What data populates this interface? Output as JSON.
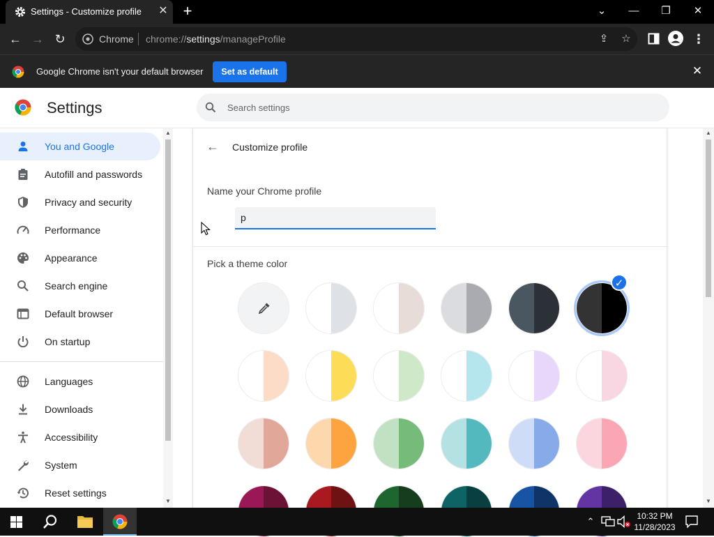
{
  "tab": {
    "title": "Settings - Customize profile",
    "close": "✕",
    "new_tab": "+"
  },
  "window": {
    "minimize": "—",
    "restore": "❐",
    "close": "✕",
    "tab_search": "⌄"
  },
  "toolbar": {
    "back": "←",
    "forward": "→",
    "reload": "↻",
    "site_label": "Chrome",
    "url_prefix": "chrome://",
    "url_host": "settings",
    "url_path": "/manageProfile"
  },
  "infobar": {
    "message": "Google Chrome isn't your default browser",
    "button": "Set as default",
    "close": "✕"
  },
  "header": {
    "title": "Settings",
    "search_placeholder": "Search settings"
  },
  "sidebar": {
    "items": [
      {
        "label": "You and Google",
        "icon": "person-icon",
        "active": true
      },
      {
        "label": "Autofill and passwords",
        "icon": "clipboard-icon"
      },
      {
        "label": "Privacy and security",
        "icon": "shield-icon"
      },
      {
        "label": "Performance",
        "icon": "speedometer-icon"
      },
      {
        "label": "Appearance",
        "icon": "palette-icon"
      },
      {
        "label": "Search engine",
        "icon": "search-icon"
      },
      {
        "label": "Default browser",
        "icon": "browser-icon"
      },
      {
        "label": "On startup",
        "icon": "power-icon"
      },
      {
        "label": "Languages",
        "icon": "globe-icon"
      },
      {
        "label": "Downloads",
        "icon": "download-icon"
      },
      {
        "label": "Accessibility",
        "icon": "accessibility-icon"
      },
      {
        "label": "System",
        "icon": "wrench-icon"
      },
      {
        "label": "Reset settings",
        "icon": "history-icon"
      }
    ]
  },
  "main": {
    "back_label": "←",
    "title": "Customize profile",
    "name_label": "Name your Chrome profile",
    "name_value": "p",
    "theme_label": "Pick a theme color",
    "selected_swatch": 5,
    "swatches": [
      [
        "#f2f3f5",
        "#f2f3f5"
      ],
      [
        "#ffffff",
        "#dee1e6"
      ],
      [
        "#ffffff",
        "#e8dcd8"
      ],
      [
        "#dadce0",
        "#a9abb1"
      ],
      [
        "#4a5761",
        "#2b3136"
      ],
      [
        "#333333",
        "#000000"
      ],
      [
        "#ffffff",
        "#fddcc7"
      ],
      [
        "#ffffff",
        "#fddd58"
      ],
      [
        "#ffffff",
        "#cfe8c8"
      ],
      [
        "#ffffff",
        "#b5e6ee"
      ],
      [
        "#ffffff",
        "#e8d6fb"
      ],
      [
        "#ffffff",
        "#f8d6e2"
      ],
      [
        "#f1dcd6",
        "#e1a89a"
      ],
      [
        "#fed8ad",
        "#fda33f"
      ],
      [
        "#c1e1c3",
        "#77bb7a"
      ],
      [
        "#b4e1e2",
        "#54b9be"
      ],
      [
        "#cfdcf8",
        "#87aae8"
      ],
      [
        "#fcd6de",
        "#faa6b5"
      ],
      [
        "#9a1856",
        "#6d1237"
      ],
      [
        "#a81a1f",
        "#6e1213"
      ],
      [
        "#1f6530",
        "#163d1d"
      ],
      [
        "#0e6364",
        "#0a3f41"
      ],
      [
        "#1754a3",
        "#0f3468"
      ],
      [
        "#6235a2",
        "#3d2168"
      ]
    ]
  },
  "taskbar": {
    "time": "10:32 PM",
    "date": "11/28/2023"
  },
  "colors": {
    "accent": "#1a73e8",
    "active_nav_bg": "#e8f0fe",
    "chrome_dark": "#252525"
  }
}
